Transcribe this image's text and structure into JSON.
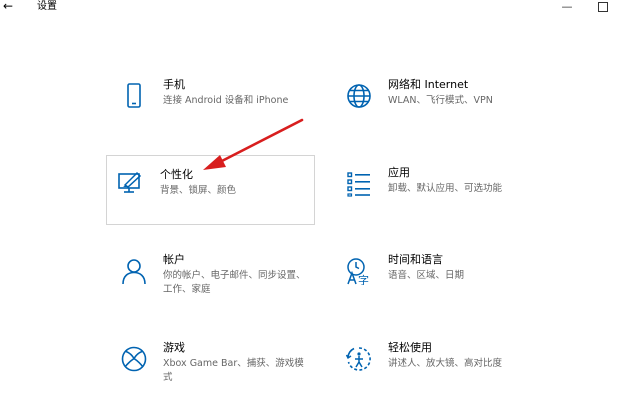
{
  "window": {
    "title": "设置",
    "back_icon": "←",
    "minimize_icon": "—"
  },
  "accent_color": "#0063b1",
  "annotation_color": "#d81e1e",
  "tiles": [
    {
      "label": "手机",
      "desc": "连接 Android 设备和 iPhone",
      "icon": "phone-icon"
    },
    {
      "label": "网络和 Internet",
      "desc": "WLAN、飞行模式、VPN",
      "icon": "globe-icon"
    },
    {
      "label": "个性化",
      "desc": "背景、锁屏、颜色",
      "icon": "personalization-icon",
      "highlighted": true
    },
    {
      "label": "应用",
      "desc": "卸载、默认应用、可选功能",
      "icon": "apps-list-icon"
    },
    {
      "label": "帐户",
      "desc": "你的帐户、电子邮件、同步设置、工作、家庭",
      "icon": "person-icon"
    },
    {
      "label": "时间和语言",
      "desc": "语音、区域、日期",
      "icon": "time-language-icon"
    },
    {
      "label": "游戏",
      "desc": "Xbox Game Bar、捕获、游戏模式",
      "icon": "xbox-icon"
    },
    {
      "label": "轻松使用",
      "desc": "讲述人、放大镜、高对比度",
      "icon": "ease-of-access-icon"
    }
  ]
}
